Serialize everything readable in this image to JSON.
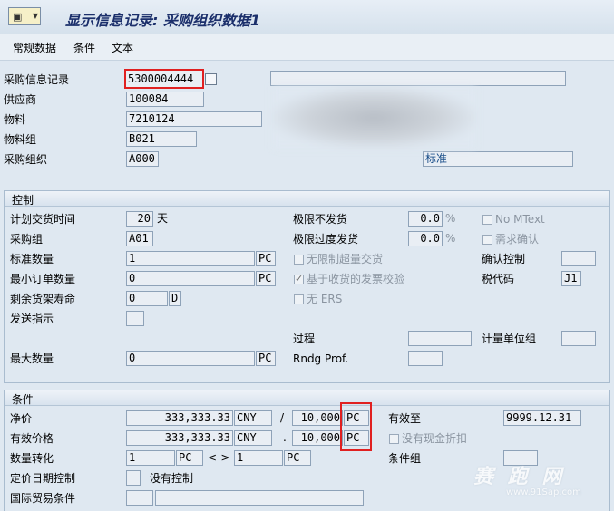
{
  "window": {
    "title": "显示信息记录: 采购组织数据1"
  },
  "tabs": [
    "常规数据",
    "条件",
    "文本"
  ],
  "header": {
    "info_record_label": "采购信息记录",
    "info_record_value": "5300004444",
    "vendor_label": "供应商",
    "vendor_value": "100084",
    "material_label": "物料",
    "material_value": "7210124",
    "material_group_label": "物料组",
    "material_group_value": "B021",
    "purch_org_label": "采购组织",
    "purch_org_value": "A000",
    "standard_value": "标准"
  },
  "control": {
    "title": "控制",
    "plan_delivery_label": "计划交货时间",
    "plan_delivery_value": "20",
    "plan_delivery_unit": "天",
    "purch_group_label": "采购组",
    "purch_group_value": "A01",
    "std_qty_label": "标准数量",
    "std_qty_value": "1",
    "std_qty_unit": "PC",
    "min_qty_label": "最小订单数量",
    "min_qty_value": "0",
    "min_qty_unit": "PC",
    "shelf_life_label": "剩余货架寿命",
    "shelf_life_value": "0",
    "shelf_life_unit": "D",
    "shipping_label": "发送指示",
    "max_qty_label": "最大数量",
    "max_qty_value": "0",
    "max_qty_unit": "PC",
    "under_tol_label": "极限不发货",
    "under_tol_value": "0.0",
    "under_tol_unit": "%",
    "over_tol_label": "极限过度发货",
    "over_tol_value": "0.0",
    "over_tol_unit": "%",
    "unlimited_label": "无限制超量交货",
    "gr_iv_label": "基于收货的发票校验",
    "no_ers_label": "无 ERS",
    "no_mtext_label": "No MText",
    "ack_req_label": "需求确认",
    "conf_ctrl_label": "确认控制",
    "tax_code_label": "税代码",
    "tax_code_value": "J1",
    "procedure_label": "过程",
    "rndg_label": "Rndg Prof.",
    "unit_group_label": "计量单位组"
  },
  "conditions": {
    "title": "条件",
    "net_price_label": "净价",
    "net_price_value": "333,333.33",
    "net_price_currency": "CNY",
    "net_per_sep": "/",
    "net_per_value": "10,000",
    "net_per_unit": "PC",
    "eff_price_label": "有效价格",
    "eff_price_value": "333,333.33",
    "eff_price_currency": "CNY",
    "eff_per_sep": ".",
    "eff_per_value": "10,000",
    "eff_per_unit": "PC",
    "valid_to_label": "有效至",
    "valid_to_value": "9999.12.31",
    "no_cash_disc_label": "没有现金折扣",
    "qty_conv_label": "数量转化",
    "qty_conv_left": "1",
    "qty_conv_left_unit": "PC",
    "qty_conv_arrow": "<->",
    "qty_conv_right": "1",
    "qty_conv_right_unit": "PC",
    "cond_group_label": "条件组",
    "pricing_date_label": "定价日期控制",
    "pricing_date_text": "没有控制",
    "incoterms_label": "国际贸易条件"
  },
  "watermark": {
    "brand": "赛 跑 网",
    "url": "www.91Sap.com"
  }
}
